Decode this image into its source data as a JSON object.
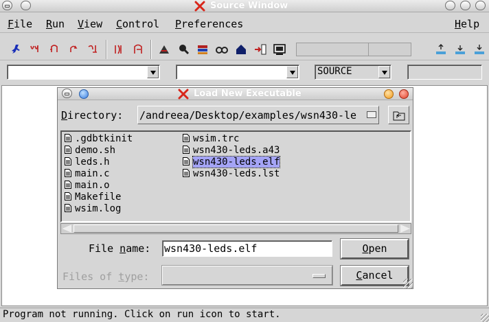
{
  "window": {
    "title": "Source Window"
  },
  "menubar": {
    "items": [
      {
        "label": "File",
        "mnemonic": "F",
        "rest": "ile"
      },
      {
        "label": "Run",
        "mnemonic": "R",
        "rest": "un"
      },
      {
        "label": "View",
        "mnemonic": "V",
        "rest": "iew"
      },
      {
        "label": "Control",
        "mnemonic": "C",
        "rest": "ontrol"
      },
      {
        "label": "Preferences",
        "mnemonic": "P",
        "rest": "references"
      },
      {
        "label": "Help",
        "mnemonic": "H",
        "rest": "elp"
      }
    ]
  },
  "toolbar": {
    "icons": [
      "run-icon",
      "step-icon",
      "next-icon",
      "finish-icon",
      "continue-icon",
      "step-asm-icon",
      "next-asm-icon",
      "up-stack-icon",
      "down-stack-icon",
      "memory-icon",
      "registers-icon",
      "watch-icon",
      "home-icon",
      "breakpoint-icon",
      "console-icon",
      "frame-up-icon",
      "frame-down-icon",
      "frame-bottom-icon"
    ]
  },
  "combos": {
    "file": "",
    "function": "",
    "mode": "SOURCE",
    "search": ""
  },
  "dialog": {
    "title": "Load New Executable",
    "directory_label": {
      "pre": "D",
      "rest": "irectory:"
    },
    "directory_value": "/andreea/Desktop/examples/wsn430-le",
    "files": [
      {
        "name": ".gdbtkinit",
        "selected": false
      },
      {
        "name": "demo.sh",
        "selected": false
      },
      {
        "name": "leds.h",
        "selected": false
      },
      {
        "name": "main.c",
        "selected": false
      },
      {
        "name": "main.o",
        "selected": false
      },
      {
        "name": "Makefile",
        "selected": false
      },
      {
        "name": "wsim.log",
        "selected": false
      },
      {
        "name": "wsim.trc",
        "selected": false
      },
      {
        "name": "wsn430-leds.a43",
        "selected": false
      },
      {
        "name": "wsn430-leds.elf",
        "selected": true
      },
      {
        "name": "wsn430-leds.lst",
        "selected": false
      }
    ],
    "file_name_label": {
      "pre": "File ",
      "mn": "n",
      "rest": "ame:"
    },
    "file_name_value": "wsn430-leds.elf",
    "open_button": {
      "mn": "O",
      "rest": "pen"
    },
    "cancel_button": {
      "mn": "C",
      "rest": "ancel"
    },
    "files_of_type_label": {
      "pre": "Files of ",
      "mn": "t",
      "rest": "ype:"
    },
    "files_of_type_value": ""
  },
  "status": {
    "text": "Program not running. Click on run icon to start."
  },
  "colors": {
    "selection": "#a4a4f6",
    "title_red_x": "#d8261a"
  }
}
